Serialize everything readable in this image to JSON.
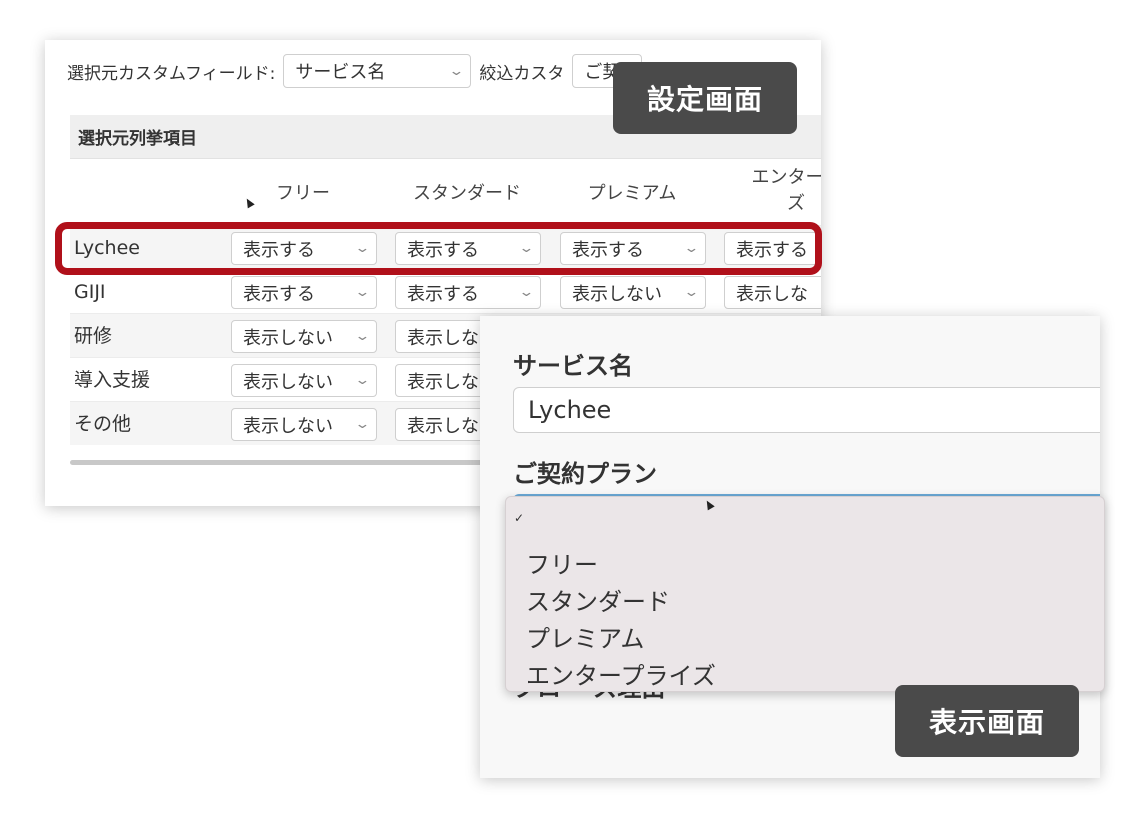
{
  "settings": {
    "source_field_label": "選択元カスタムフィールド:",
    "source_field_value": "サービス名",
    "filter_field_label_visible": "絞込カスタ",
    "filter_field_value_visible": "ご契",
    "section_title": "選択元列挙項目",
    "columns": [
      "フリー",
      "スタンダード",
      "プレミアム",
      "エンタープ\nズ"
    ],
    "rows": [
      {
        "label": "Lychee",
        "values": [
          "表示する",
          "表示する",
          "表示する",
          "表示する"
        ]
      },
      {
        "label": "GIJI",
        "values": [
          "表示する",
          "表示する",
          "表示しない",
          "表示しな"
        ]
      },
      {
        "label": "研修",
        "values": [
          "表示しない",
          "表示しな",
          "",
          ""
        ]
      },
      {
        "label": "導入支援",
        "values": [
          "表示しない",
          "表示しな",
          "",
          ""
        ]
      },
      {
        "label": "その他",
        "values": [
          "表示しない",
          "表示しな",
          "",
          ""
        ]
      }
    ]
  },
  "tags": {
    "settings": "設定画面",
    "display": "表示画面"
  },
  "display": {
    "service_label": "サービス名",
    "service_value": "Lychee",
    "plan_label": "ご契約プラン",
    "plan_options": [
      "フリー",
      "スタンダード",
      "プレミアム",
      "エンタープライズ"
    ],
    "check_mark": "✓",
    "next_label_partial": "クロー ズ理由"
  },
  "colors": {
    "highlight": "#b0101a",
    "tag_bg": "#4a4a4a",
    "focus_border": "#6aa9d6",
    "dropdown_bg": "#ebe6e8"
  }
}
